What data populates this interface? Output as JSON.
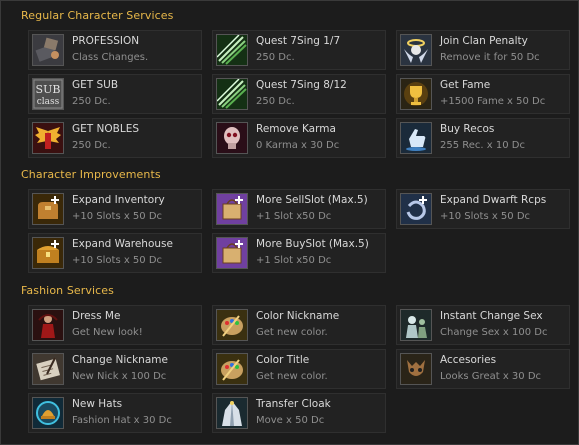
{
  "sections": [
    {
      "title": "Regular Character Services",
      "items": [
        {
          "name": "PROFESSION",
          "desc": "Class Changes.",
          "icon": "profession-icon"
        },
        {
          "name": "Quest 7Sing 1/7",
          "desc": "250 Dc.",
          "icon": "quest-blades-icon"
        },
        {
          "name": "Join Clan Penalty",
          "desc": "Remove it for 50 Dc",
          "icon": "clan-angel-icon"
        },
        {
          "name": "GET SUB",
          "desc": "250 Dc.",
          "icon": "subclass-icon",
          "badge": [
            "SUB",
            "class"
          ]
        },
        {
          "name": "Quest 7Sing 8/12",
          "desc": "250 Dc.",
          "icon": "quest-blades-icon"
        },
        {
          "name": "Get Fame",
          "desc": "+1500 Fame x 50 Dc",
          "icon": "fame-trophy-icon"
        },
        {
          "name": "GET NOBLES",
          "desc": "250 Dc.",
          "icon": "nobles-wings-icon"
        },
        {
          "name": "Remove Karma",
          "desc": "0 Karma x 30 Dc",
          "icon": "karma-skull-icon"
        },
        {
          "name": "Buy Recos",
          "desc": "255 Rec. x 10 Dc",
          "icon": "recommend-hand-icon"
        }
      ]
    },
    {
      "title": "Character Improvements",
      "items": [
        {
          "name": "Expand Inventory",
          "desc": "+10 Slots x 50 Dc",
          "icon": "inventory-bag-icon"
        },
        {
          "name": "More SellSlot (Max.5)",
          "desc": "+1 Slot x50 Dc",
          "icon": "sell-bag-icon"
        },
        {
          "name": "Expand Dwarft Rcps",
          "desc": "+10 Slots x 50 Dc",
          "icon": "recipe-ring-icon"
        },
        {
          "name": "Expand Warehouse",
          "desc": "+10 Slots x 50 Dc",
          "icon": "warehouse-chest-icon"
        },
        {
          "name": "More BuySlot (Max.5)",
          "desc": "+1 Slot x50 Dc",
          "icon": "buy-bag-icon"
        }
      ]
    },
    {
      "title": "Fashion Services",
      "items": [
        {
          "name": "Dress Me",
          "desc": "Get New look!",
          "icon": "dress-me-icon"
        },
        {
          "name": "Color Nickname",
          "desc": "Get new color.",
          "icon": "palette-icon"
        },
        {
          "name": "Instant Change Sex",
          "desc": "Change Sex x 100 Dc",
          "icon": "change-sex-icon"
        },
        {
          "name": "Change Nickname",
          "desc": "New Nick x 100 Dc",
          "icon": "scroll-quill-icon"
        },
        {
          "name": "Color Title",
          "desc": "Get new color.",
          "icon": "palette-icon"
        },
        {
          "name": "Accesories",
          "desc": "Looks Great x 30 Dc",
          "icon": "accessory-mask-icon"
        },
        {
          "name": "New Hats",
          "desc": "Fashion Hat x 30 Dc",
          "icon": "hat-crest-icon"
        },
        {
          "name": "Transfer Cloak",
          "desc": "Move x 50 Dc",
          "icon": "cloak-icon"
        }
      ]
    }
  ]
}
